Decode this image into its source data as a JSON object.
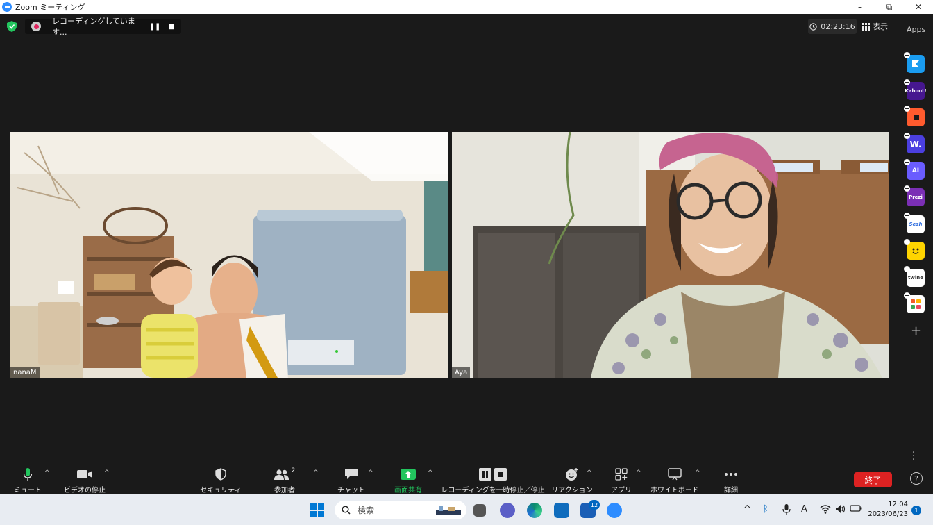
{
  "window": {
    "title": "Zoom ミーティング",
    "minimize": "–",
    "maximize": "⧉",
    "close": "✕"
  },
  "recording": {
    "status": "レコーディングしています...",
    "pause": "❚❚",
    "stop": "■"
  },
  "timer": {
    "value": "02:23:16"
  },
  "view": {
    "label": "表示"
  },
  "apps_panel": {
    "label": "Apps",
    "items": [
      {
        "name": "Slido-like",
        "text": "",
        "color": "#1a9cf0"
      },
      {
        "name": "Kahoot",
        "text": "Kahoot!",
        "color": "#46178f"
      },
      {
        "name": "Orange",
        "text": "",
        "color": "#ff5b2e"
      },
      {
        "name": "Wooclap",
        "text": "W.",
        "color": "#4b3fe0"
      },
      {
        "name": "AI",
        "text": "AI",
        "color": "#6a5cff"
      },
      {
        "name": "Prezi",
        "text": "Prezi",
        "color": "#7b2fb5"
      },
      {
        "name": "Sesh",
        "text": "Sesh",
        "color": "#ffffff"
      },
      {
        "name": "Smile",
        "text": "",
        "color": "#ffd400"
      },
      {
        "name": "Twine",
        "text": "twine",
        "color": "#ffffff"
      },
      {
        "name": "Grid",
        "text": "",
        "color": "#ffffff"
      }
    ]
  },
  "participants": [
    {
      "name": "nanaM"
    },
    {
      "name": "Aya"
    }
  ],
  "toolbar": {
    "mute": "ミュート",
    "video": "ビデオの停止",
    "security": "セキュリティ",
    "participants": "参加者",
    "participants_count": "2",
    "chat": "チャット",
    "share": "画面共有",
    "recording": "レコーディングを一時停止／停止",
    "reactions": "リアクション",
    "apps": "アプリ",
    "whiteboard": "ホワイトボード",
    "more": "詳細",
    "end": "終了"
  },
  "taskbar": {
    "search_placeholder": "検索",
    "badge_count": "12",
    "time": "12:04",
    "date": "2023/06/23",
    "notifications": "1"
  },
  "colors": {
    "share_green": "#22c55e",
    "end_red": "#d22222",
    "accent": "#2d8cff"
  }
}
